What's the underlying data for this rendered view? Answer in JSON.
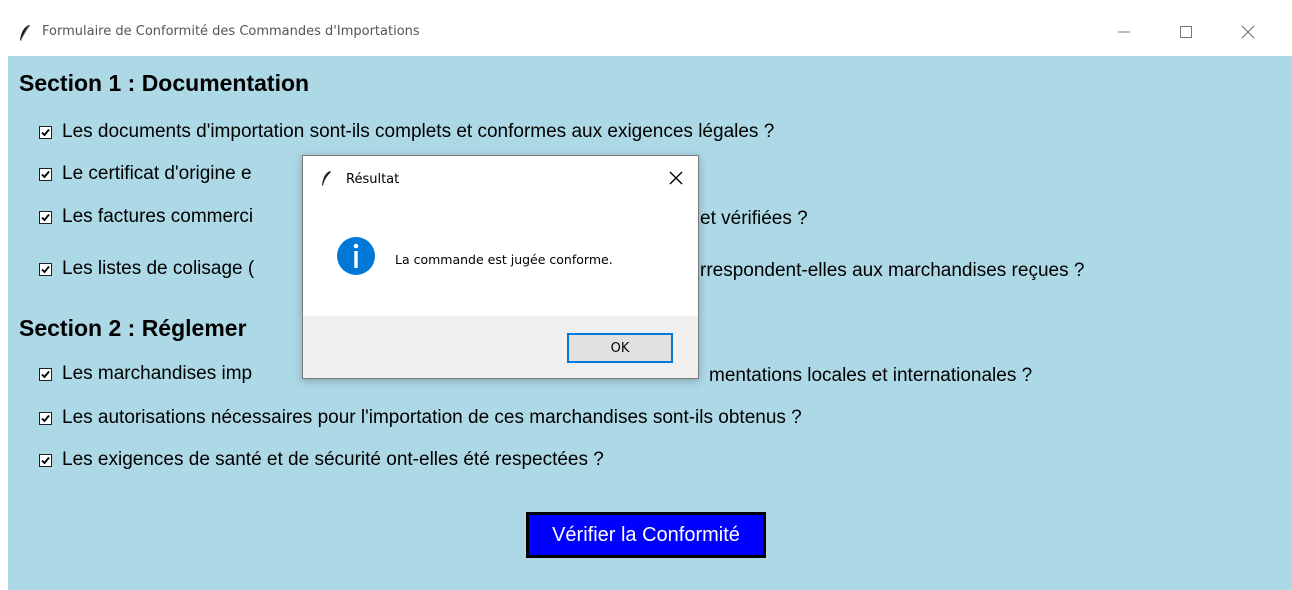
{
  "window": {
    "title": "Formulaire de Conformité des Commandes d'Importations"
  },
  "section1": {
    "title": "Section 1 : Documentation",
    "items": [
      {
        "label": "Les documents d'importation sont-ils complets et conformes aux exigences légales ?",
        "checked": true
      },
      {
        "label": "Le certificat d'origine e",
        "checked": true
      },
      {
        "label": "Les factures commerci",
        "label_after": "et vérifiées ?",
        "checked": true
      },
      {
        "label": "Les listes de colisage (",
        "label_after": "rrespondent-elles aux marchandises reçues ?",
        "checked": true
      }
    ]
  },
  "section2": {
    "title": "Section 2 : Réglemer",
    "items": [
      {
        "label": "Les marchandises imp",
        "label_after": "mentations locales et internationales ?",
        "checked": true
      },
      {
        "label": "Les autorisations nécessaires pour l'importation de ces marchandises sont-ils obtenus ?",
        "checked": true
      },
      {
        "label": "Les exigences de santé et de sécurité ont-elles été respectées ?",
        "checked": true
      }
    ]
  },
  "verify_button": {
    "label": "Vérifier la Conformité"
  },
  "dialog": {
    "title": "Résultat",
    "message": "La commande est jugée conforme.",
    "ok_label": "OK",
    "icon": "info-icon"
  },
  "colors": {
    "content_bg": "#add8e6",
    "button_bg": "#0000ff",
    "info_blue": "#0078d7"
  }
}
